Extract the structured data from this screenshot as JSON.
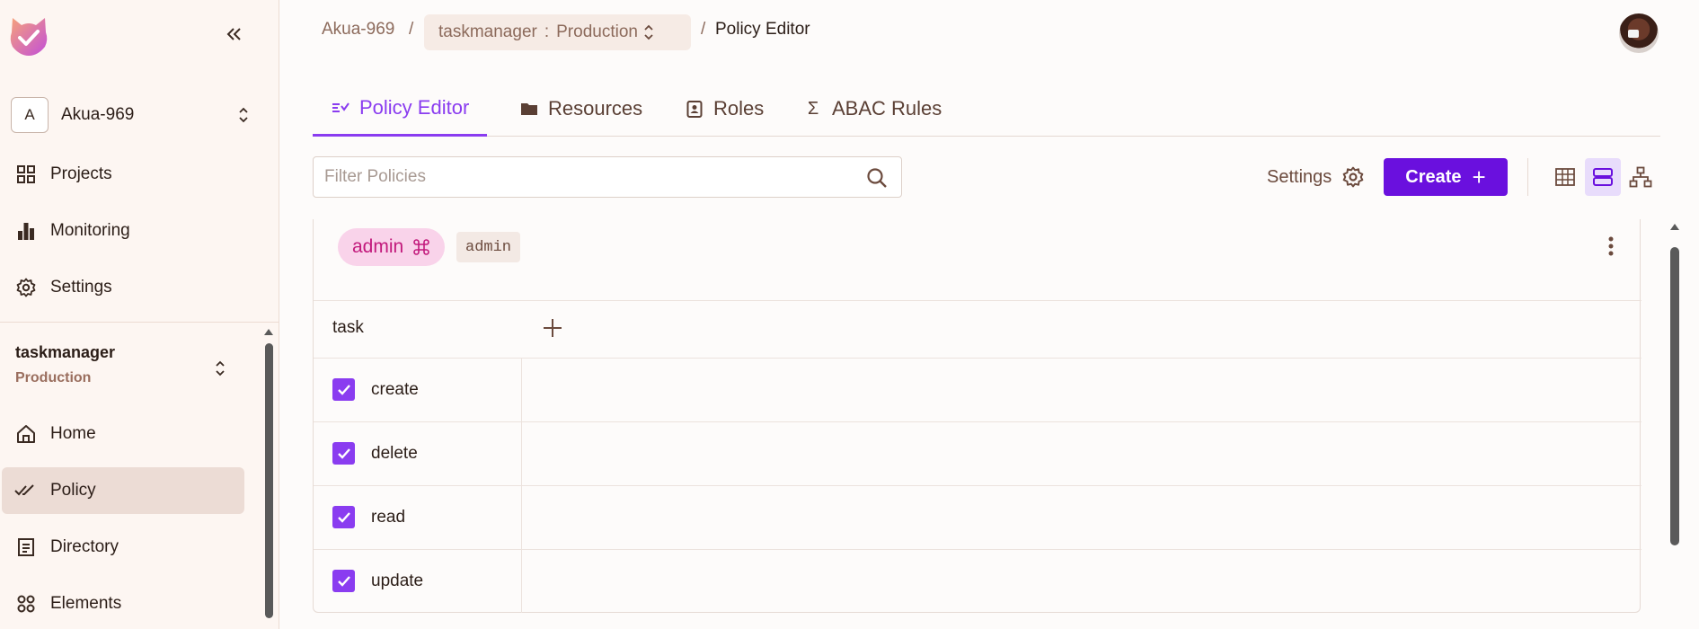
{
  "sidebar": {
    "org": {
      "avatar_letter": "A",
      "name": "Akua-969"
    },
    "top_items": [
      {
        "label": "Projects",
        "icon": "grid-icon"
      },
      {
        "label": "Monitoring",
        "icon": "bar-chart-icon"
      },
      {
        "label": "Settings",
        "icon": "gear-icon"
      }
    ],
    "environment": {
      "name": "taskmanager",
      "stage": "Production"
    },
    "items": [
      {
        "label": "Home",
        "icon": "home-icon"
      },
      {
        "label": "Policy",
        "icon": "double-check-icon",
        "active": true
      },
      {
        "label": "Directory",
        "icon": "directory-icon"
      },
      {
        "label": "Elements",
        "icon": "elements-icon"
      }
    ]
  },
  "breadcrumb": {
    "org": "Akua-969",
    "separator": "/",
    "project": "taskmanager",
    "colon": ":",
    "env": "Production",
    "current": "Policy Editor"
  },
  "tabs": [
    {
      "label": "Policy Editor",
      "icon": "policy-list-icon",
      "active": true
    },
    {
      "label": "Resources",
      "icon": "folder-icon"
    },
    {
      "label": "Roles",
      "icon": "contact-icon"
    },
    {
      "label": "ABAC Rules",
      "icon": "sigma-icon"
    }
  ],
  "toolbar": {
    "filter_placeholder": "Filter Policies",
    "settings_label": "Settings",
    "create_label": "Create"
  },
  "policy": {
    "role_label": "admin",
    "role_key": "admin",
    "resource": "task",
    "actions": [
      {
        "label": "create",
        "checked": true
      },
      {
        "label": "delete",
        "checked": true
      },
      {
        "label": "read",
        "checked": true
      },
      {
        "label": "update",
        "checked": true
      }
    ]
  },
  "colors": {
    "accent": "#8a3cf0",
    "primary_button": "#6a10de",
    "role_chip_bg": "#f9d3ea",
    "role_chip_text": "#c21a7c"
  }
}
